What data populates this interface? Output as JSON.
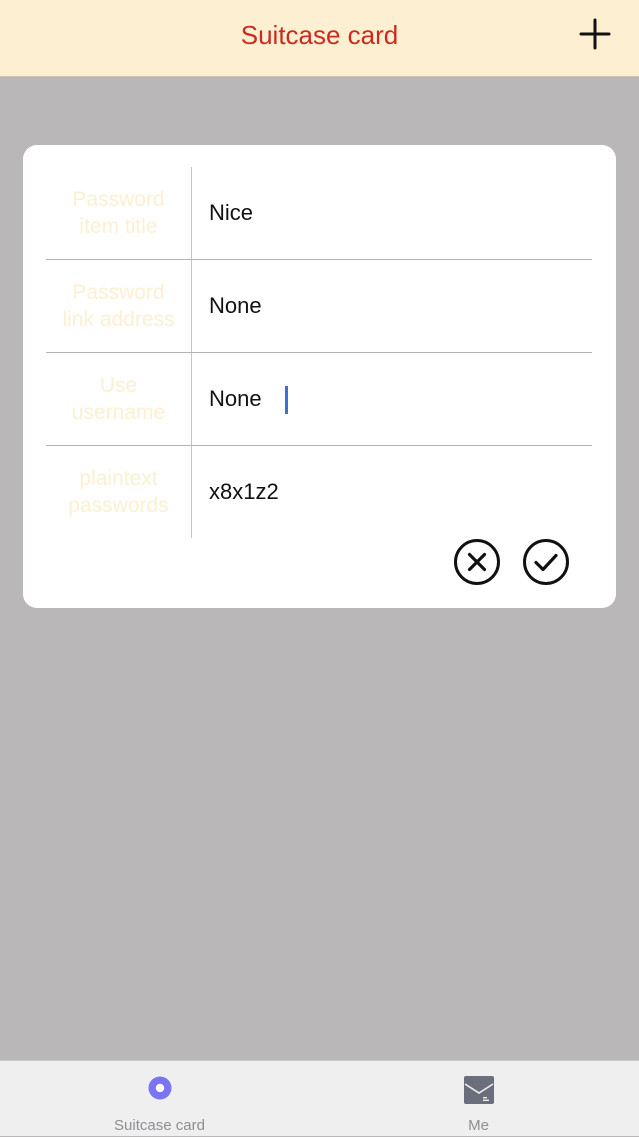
{
  "navbar": {
    "title": "Suitcase card",
    "add_icon": "plus-icon"
  },
  "dialog": {
    "rows": [
      {
        "label": "Password item title",
        "value": "Nice"
      },
      {
        "label": "Password link address",
        "value": "None"
      },
      {
        "label": "Use username",
        "value": "None"
      },
      {
        "label": "plaintext passwords",
        "value": "x8x1z2"
      }
    ],
    "cancel_icon": "close-circle-icon",
    "confirm_icon": "check-circle-icon"
  },
  "tabbar": {
    "tabs": [
      {
        "label": "Suitcase card",
        "icon": "record-circle-icon",
        "color": "#7b74f0"
      },
      {
        "label": "Me",
        "icon": "mail-icon",
        "color": "#6b6e7d"
      }
    ]
  },
  "colors": {
    "navbar_bg": "#fdf0d2",
    "title": "#cc2a1e",
    "overlay": "#b9b7b7",
    "label": "#fdf0d2",
    "caret": "#3b6fe0"
  }
}
